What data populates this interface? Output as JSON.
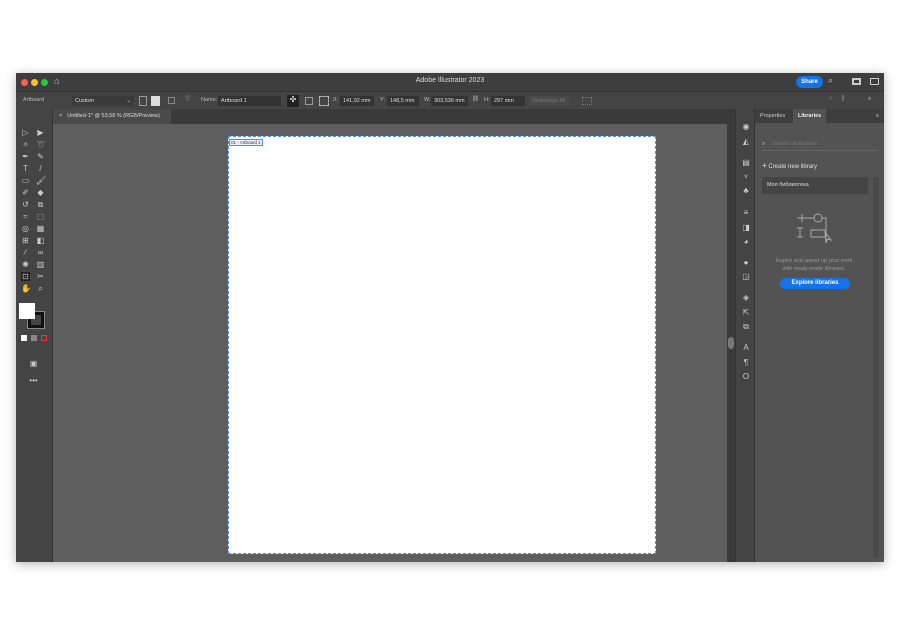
{
  "window": {
    "title": "Adobe Illustrator 2023",
    "share": "Share"
  },
  "control_bar": {
    "mode": "Artboard",
    "preset": "Custom",
    "name_label": "Name:",
    "name_value": "Artboard 1",
    "x_label": "X:",
    "x": "141,92 mm",
    "y_label": "Y:",
    "y": "148,5 mm",
    "w_label": "W:",
    "w": "303,536 mm",
    "h_label": "H:",
    "h": "297 mm",
    "rearrange": "Rearrange All"
  },
  "document_tab": {
    "title": "Untitled-1* @ 53,58 % (RGB/Preview)"
  },
  "artboard": {
    "label": "01 - Artboard 1"
  },
  "panel": {
    "tabs": [
      "Properties",
      "Libraries"
    ],
    "active_tab": "Libraries",
    "search_placeholder": "Search all libraries",
    "create_label": "Create new library",
    "library_name": "Моя библиотека",
    "description_line1": "Inspire and speed up your work",
    "description_line2": "with ready-made libraries.",
    "explore_button": "Explore libraries"
  }
}
